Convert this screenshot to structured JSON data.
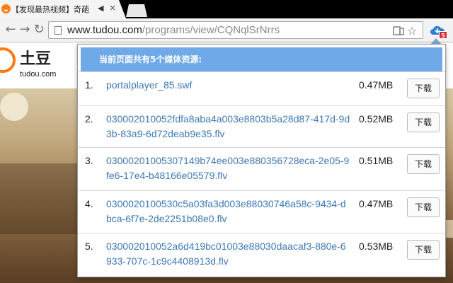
{
  "tab": {
    "title": "【发现最热视频】奇葩"
  },
  "toolbar": {
    "url_host": "www.tudou.com",
    "url_path": "/programs/view/CQNqlSrNrrs",
    "extension_badge": "5"
  },
  "site": {
    "logo_text": "土豆",
    "logo_domain": "tudou.com"
  },
  "popup": {
    "header": "当前页面共有5个媒体资源:",
    "items": [
      {
        "num": "1.",
        "name": "portalplayer_85.swf",
        "size": "0.47MB",
        "button": "下载"
      },
      {
        "num": "2.",
        "name": "030002010052fdfa8aba4a003e8803b5a28d87-417d-9d3b-83a9-6d72deab9e35.flv",
        "size": "0.52MB",
        "button": "下载"
      },
      {
        "num": "3.",
        "name": "03000201005307149b74ee003e880356728eca-2e05-9fe6-17e4-b48166e05579.flv",
        "size": "0.51MB",
        "button": "下载"
      },
      {
        "num": "4.",
        "name": "0300020100530c5a03fa3d003e88030746a58c-9434-dbca-6f7e-2de2251b08e0.flv",
        "size": "0.47MB",
        "button": "下载"
      },
      {
        "num": "5.",
        "name": "030002010052a6d419bc01003e88030daacaf3-880e-6933-707c-1c9c4408913d.flv",
        "size": "0.53MB",
        "button": "下载"
      }
    ]
  }
}
